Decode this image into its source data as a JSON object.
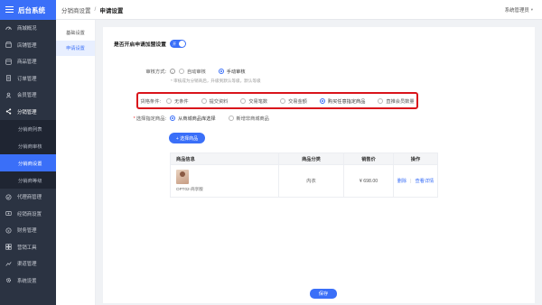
{
  "app": {
    "title": "后台系统"
  },
  "sidebar": {
    "items": [
      {
        "label": "商城概况",
        "icon": "speedometer-icon"
      },
      {
        "label": "店铺管理",
        "icon": "store-icon"
      },
      {
        "label": "商品管理",
        "icon": "goods-icon"
      },
      {
        "label": "订单管理",
        "icon": "order-icon"
      },
      {
        "label": "会员管理",
        "icon": "user-icon"
      },
      {
        "label": "分销管理",
        "icon": "share-icon"
      }
    ],
    "sub_items": [
      {
        "label": "分销商列表"
      },
      {
        "label": "分销商审核"
      },
      {
        "label": "分销商设置"
      },
      {
        "label": "分销商等级"
      }
    ],
    "items_after": [
      {
        "label": "代理商管理",
        "icon": "agent-icon"
      },
      {
        "label": "经销商设置",
        "icon": "dealer-icon"
      },
      {
        "label": "财务管理",
        "icon": "finance-icon"
      },
      {
        "label": "营销工具",
        "icon": "marketing-icon"
      },
      {
        "label": "渠道管理",
        "icon": "channel-icon"
      },
      {
        "label": "系统设置",
        "icon": "gear-icon"
      }
    ]
  },
  "header": {
    "breadcrumb_parent": "分销商设置",
    "breadcrumb_separator": "/",
    "breadcrumb_current": "申请设置",
    "user": "系统管理员"
  },
  "submenu": {
    "items": [
      {
        "label": "基础设置"
      },
      {
        "label": "申请设置"
      }
    ]
  },
  "form": {
    "toggle_label": "是否开启申请加盟设置",
    "toggle_value": "开",
    "audit_label": "审核方式:",
    "audit_options": [
      {
        "label": "自动审核"
      },
      {
        "label": "手动审核"
      }
    ],
    "audit_hint": "* 审核成为分销商后，升级到默认等级，默认等级",
    "condition_label": "货格条件:",
    "condition_options": [
      {
        "label": "无条件"
      },
      {
        "label": "提交资料"
      },
      {
        "label": "交易笔数"
      },
      {
        "label": "交易金额"
      },
      {
        "label": "购买任意指定商品"
      },
      {
        "label": "直推会员数量"
      }
    ],
    "goods_label": "选择指定商品:",
    "goods_options": [
      {
        "label": "从商城商品库选择"
      },
      {
        "label": "新增非商城商品"
      }
    ],
    "select_button": "+ 选择商品",
    "table": {
      "headers": [
        "商品信息",
        "商品分类",
        "销售价",
        "操作"
      ],
      "rows": [
        {
          "name": "OPT02-商享版",
          "category": "内衣",
          "price": "¥ 698.00",
          "op_delete": "删除",
          "op_view": "查看详情"
        }
      ]
    },
    "save_button": "保存"
  },
  "colors": {
    "accent": "#3a6ff8",
    "sidebar": "#2b3342",
    "highlight_box": "#d9141b"
  }
}
